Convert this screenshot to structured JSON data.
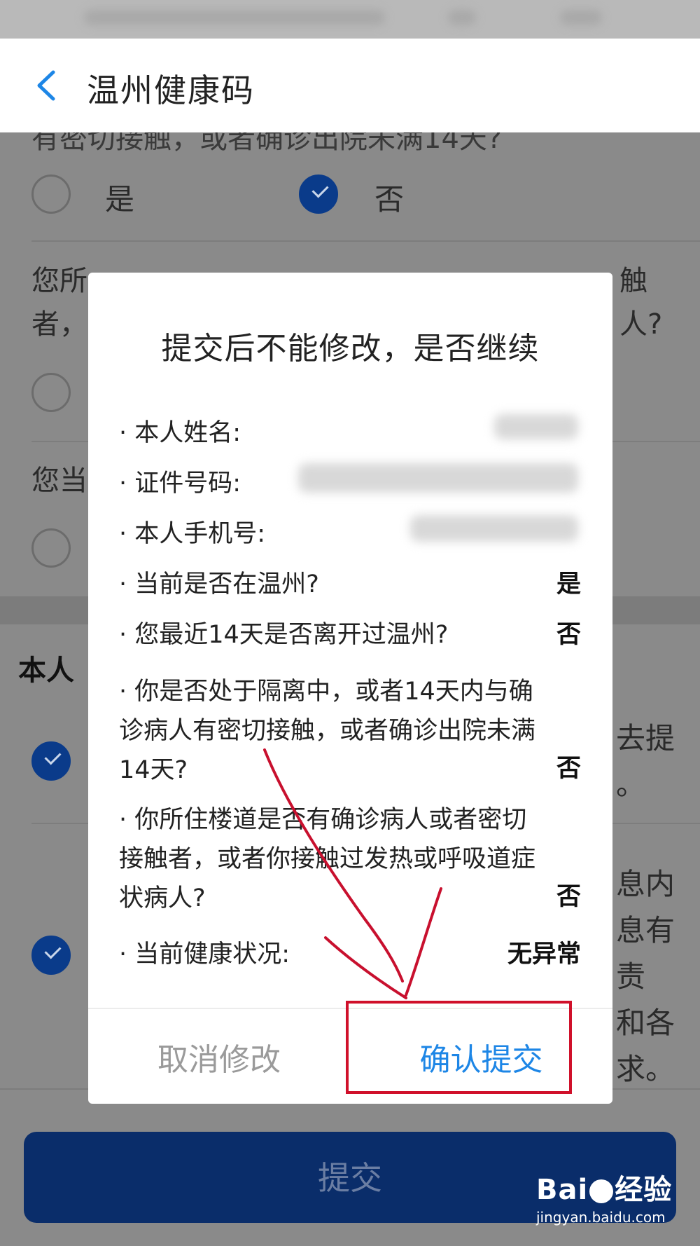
{
  "app_bar": {
    "title": "温州健康码"
  },
  "background": {
    "q1_tail": "有密切接触，或者确诊出院未满14天?",
    "option_yes": "是",
    "option_no": "否",
    "q2_line1": "您所",
    "q2_line2": "者，",
    "q2_tail1": "触",
    "q2_tail2": "人?",
    "q3_head": "您当",
    "section_title": "本人",
    "right_frag1": "去提",
    "right_frag2": "。",
    "right_frag3": "息内",
    "right_frag4": "息有",
    "right_frag5": "责",
    "right_frag6": "和各",
    "right_frag7": "求。",
    "submit_label": "提交"
  },
  "dialog": {
    "title": "提交后不能修改，是否继续",
    "rows": [
      {
        "label": "· 本人姓名:"
      },
      {
        "label": "· 证件号码:"
      },
      {
        "label": "· 本人手机号:"
      },
      {
        "label": "· 当前是否在温州?",
        "value": "是"
      },
      {
        "label": "· 您最近14天是否离开过温州?",
        "value": "否"
      }
    ],
    "q_isolation": {
      "line1": "· 你是否处于隔离中，或者14天内与确",
      "line2": "诊病人有密切接触，或者确诊出院未满",
      "line3": "14天?",
      "value": "否"
    },
    "q_building": {
      "line1": "· 你所住楼道是否有确诊病人或者密切",
      "line2": "接触者，或者你接触过发热或呼吸道症",
      "line3": "状病人?",
      "value": "否"
    },
    "health": {
      "label": "· 当前健康状况:",
      "value": "无异常"
    },
    "cancel_label": "取消修改",
    "confirm_label": "确认提交"
  },
  "watermark": {
    "brand_left": "Bai",
    "brand_right": "经验",
    "site": "jingyan.baidu.com"
  },
  "colors": {
    "accent": "#1d86e6",
    "highlight": "#d0102a",
    "primary_dark": "#0a2d6a"
  }
}
